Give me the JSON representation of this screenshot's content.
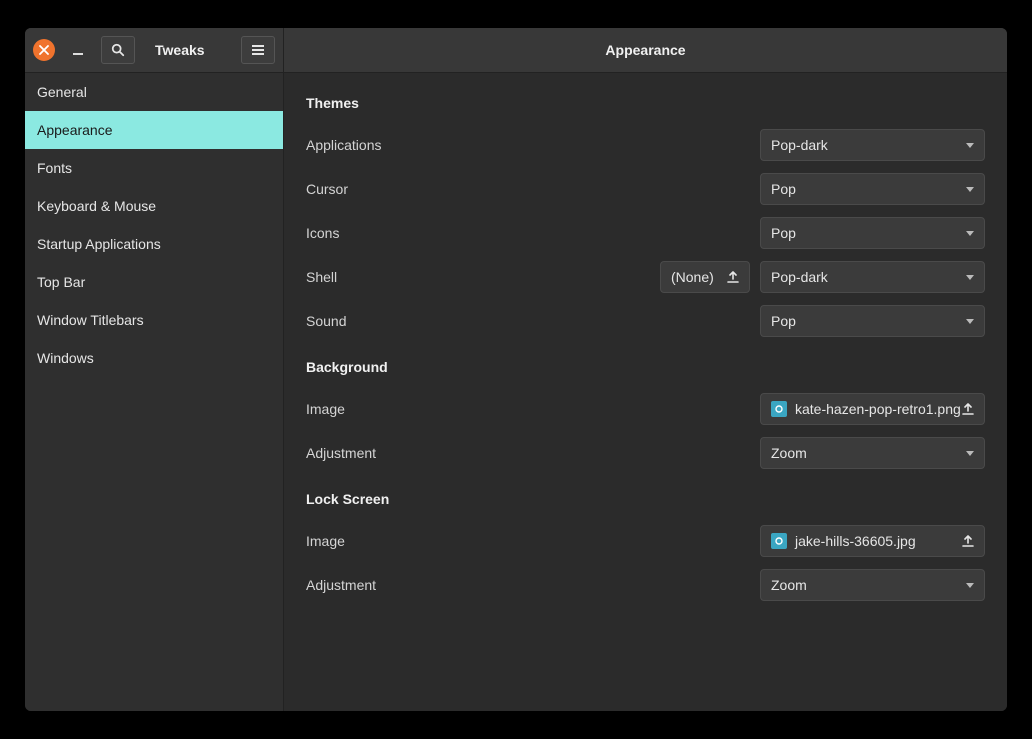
{
  "header": {
    "app_title": "Tweaks",
    "page_title": "Appearance"
  },
  "sidebar": {
    "items": [
      {
        "label": "General",
        "active": false
      },
      {
        "label": "Appearance",
        "active": true
      },
      {
        "label": "Fonts",
        "active": false
      },
      {
        "label": "Keyboard & Mouse",
        "active": false
      },
      {
        "label": "Startup Applications",
        "active": false
      },
      {
        "label": "Top Bar",
        "active": false
      },
      {
        "label": "Window Titlebars",
        "active": false
      },
      {
        "label": "Windows",
        "active": false
      }
    ]
  },
  "sections": {
    "themes": {
      "title": "Themes",
      "applications": {
        "label": "Applications",
        "value": "Pop-dark"
      },
      "cursor": {
        "label": "Cursor",
        "value": "Pop"
      },
      "icons": {
        "label": "Icons",
        "value": "Pop"
      },
      "shell": {
        "label": "Shell",
        "none_label": "(None)",
        "value": "Pop-dark"
      },
      "sound": {
        "label": "Sound",
        "value": "Pop"
      }
    },
    "background": {
      "title": "Background",
      "image": {
        "label": "Image",
        "value": "kate-hazen-pop-retro1.png"
      },
      "adjustment": {
        "label": "Adjustment",
        "value": "Zoom"
      }
    },
    "lockscreen": {
      "title": "Lock Screen",
      "image": {
        "label": "Image",
        "value": "jake-hills-36605.jpg"
      },
      "adjustment": {
        "label": "Adjustment",
        "value": "Zoom"
      }
    }
  }
}
